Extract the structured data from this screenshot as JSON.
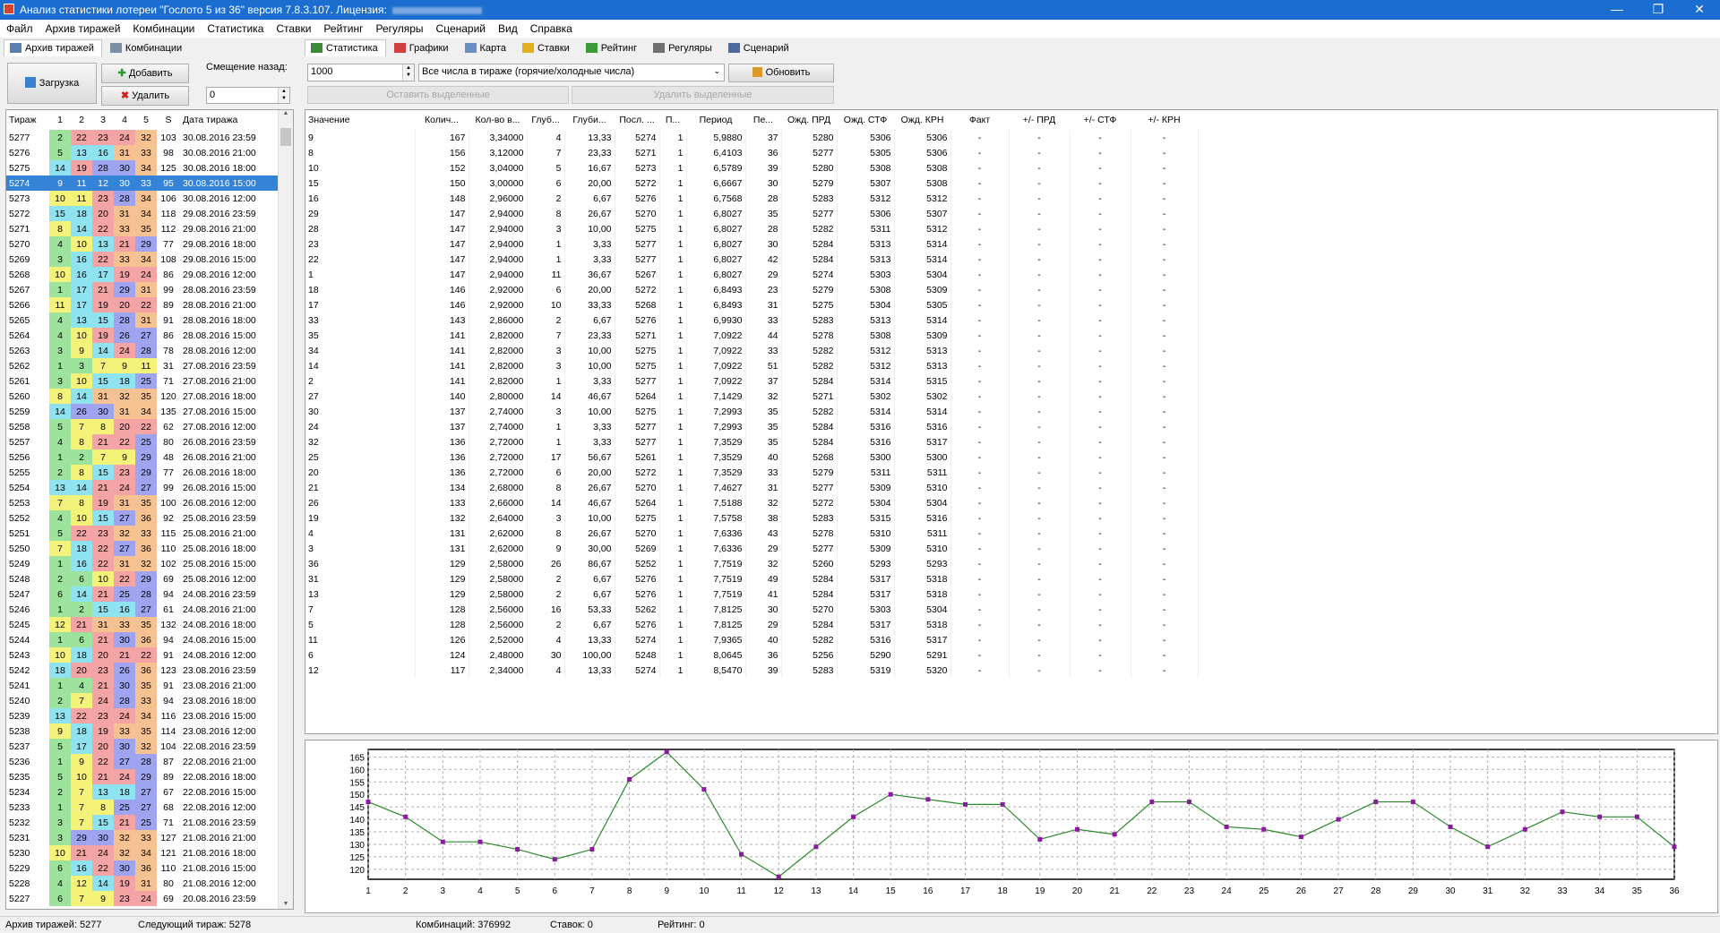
{
  "window": {
    "title": "Анализ статистики лотереи \"Гослото 5 из 36\" версия 7.8.3.107. Лицензия:",
    "min": "—",
    "max": "❐",
    "close": "✕"
  },
  "menu": [
    "Файл",
    "Архив тиражей",
    "Комбинации",
    "Статистика",
    "Ставки",
    "Рейтинг",
    "Регуляры",
    "Сценарий",
    "Вид",
    "Справка"
  ],
  "left_tabs": [
    {
      "label": "Архив тиражей",
      "icon": "archive-icon",
      "active": true
    },
    {
      "label": "Комбинации",
      "icon": "combinations-icon",
      "active": false
    }
  ],
  "right_tabs": [
    {
      "label": "Статистика",
      "icon": "statistics-icon",
      "active": true
    },
    {
      "label": "Графики",
      "icon": "graph-icon",
      "active": false
    },
    {
      "label": "Карта",
      "icon": "map-icon",
      "active": false
    },
    {
      "label": "Ставки",
      "icon": "coins-icon",
      "active": false
    },
    {
      "label": "Рейтинг",
      "icon": "rating-icon",
      "active": false
    },
    {
      "label": "Регуляры",
      "icon": "regulars-icon",
      "active": false
    },
    {
      "label": "Сценарий",
      "icon": "scenario-icon",
      "active": false
    }
  ],
  "archive_controls": {
    "load": "Загрузка",
    "add": "Добавить",
    "delete": "Удалить",
    "offset_label": "Смещение назад:",
    "offset_value": "0"
  },
  "stats_controls": {
    "count_value": "1000",
    "filter_value": "Все числа в тираже (горячие/холодные числа)",
    "refresh": "Обновить",
    "keep_selected": "Оставить выделенные",
    "delete_selected": "Удалить выделенные"
  },
  "colors": {
    "green": "#9de39d",
    "cyan": "#8fe3f0",
    "red": "#f4a4a4",
    "yellow": "#f5f27a",
    "blue": "#9fa4f0",
    "orange": "#f7c291",
    "selected": "#3483d6"
  },
  "archive_headers": [
    "Тираж",
    "1",
    "2",
    "3",
    "4",
    "5",
    "S",
    "Дата тиража"
  ],
  "archive_rows": [
    [
      "5277",
      "2",
      "22",
      "23",
      "24",
      "32",
      "103",
      "30.08.2016 23:59"
    ],
    [
      "5276",
      "5",
      "13",
      "16",
      "31",
      "33",
      "98",
      "30.08.2016 21:00"
    ],
    [
      "5275",
      "14",
      "19",
      "28",
      "30",
      "34",
      "125",
      "30.08.2016 18:00"
    ],
    [
      "5274",
      "9",
      "11",
      "12",
      "30",
      "33",
      "95",
      "30.08.2016 15:00"
    ],
    [
      "5273",
      "10",
      "11",
      "23",
      "28",
      "34",
      "106",
      "30.08.2016 12:00"
    ],
    [
      "5272",
      "15",
      "18",
      "20",
      "31",
      "34",
      "118",
      "29.08.2016 23:59"
    ],
    [
      "5271",
      "8",
      "14",
      "22",
      "33",
      "35",
      "112",
      "29.08.2016 21:00"
    ],
    [
      "5270",
      "4",
      "10",
      "13",
      "21",
      "29",
      "77",
      "29.08.2016 18:00"
    ],
    [
      "5269",
      "3",
      "16",
      "22",
      "33",
      "34",
      "108",
      "29.08.2016 15:00"
    ],
    [
      "5268",
      "10",
      "16",
      "17",
      "19",
      "24",
      "86",
      "29.08.2016 12:00"
    ],
    [
      "5267",
      "1",
      "17",
      "21",
      "29",
      "31",
      "99",
      "28.08.2016 23:59"
    ],
    [
      "5266",
      "11",
      "17",
      "19",
      "20",
      "22",
      "89",
      "28.08.2016 21:00"
    ],
    [
      "5265",
      "4",
      "13",
      "15",
      "28",
      "31",
      "91",
      "28.08.2016 18:00"
    ],
    [
      "5264",
      "4",
      "10",
      "19",
      "26",
      "27",
      "86",
      "28.08.2016 15:00"
    ],
    [
      "5263",
      "3",
      "9",
      "14",
      "24",
      "28",
      "78",
      "28.08.2016 12:00"
    ],
    [
      "5262",
      "1",
      "3",
      "7",
      "9",
      "11",
      "31",
      "27.08.2016 23:59"
    ],
    [
      "5261",
      "3",
      "10",
      "15",
      "18",
      "25",
      "71",
      "27.08.2016 21:00"
    ],
    [
      "5260",
      "8",
      "14",
      "31",
      "32",
      "35",
      "120",
      "27.08.2016 18:00"
    ],
    [
      "5259",
      "14",
      "26",
      "30",
      "31",
      "34",
      "135",
      "27.08.2016 15:00"
    ],
    [
      "5258",
      "5",
      "7",
      "8",
      "20",
      "22",
      "62",
      "27.08.2016 12:00"
    ],
    [
      "5257",
      "4",
      "8",
      "21",
      "22",
      "25",
      "80",
      "26.08.2016 23:59"
    ],
    [
      "5256",
      "1",
      "2",
      "7",
      "9",
      "29",
      "48",
      "26.08.2016 21:00"
    ],
    [
      "5255",
      "2",
      "8",
      "15",
      "23",
      "29",
      "77",
      "26.08.2016 18:00"
    ],
    [
      "5254",
      "13",
      "14",
      "21",
      "24",
      "27",
      "99",
      "26.08.2016 15:00"
    ],
    [
      "5253",
      "7",
      "8",
      "19",
      "31",
      "35",
      "100",
      "26.08.2016 12:00"
    ],
    [
      "5252",
      "4",
      "10",
      "15",
      "27",
      "36",
      "92",
      "25.08.2016 23:59"
    ],
    [
      "5251",
      "5",
      "22",
      "23",
      "32",
      "33",
      "115",
      "25.08.2016 21:00"
    ],
    [
      "5250",
      "7",
      "18",
      "22",
      "27",
      "36",
      "110",
      "25.08.2016 18:00"
    ],
    [
      "5249",
      "1",
      "16",
      "22",
      "31",
      "32",
      "102",
      "25.08.2016 15:00"
    ],
    [
      "5248",
      "2",
      "6",
      "10",
      "22",
      "29",
      "69",
      "25.08.2016 12:00"
    ],
    [
      "5247",
      "6",
      "14",
      "21",
      "25",
      "28",
      "94",
      "24.08.2016 23:59"
    ],
    [
      "5246",
      "1",
      "2",
      "15",
      "16",
      "27",
      "61",
      "24.08.2016 21:00"
    ],
    [
      "5245",
      "12",
      "21",
      "31",
      "33",
      "35",
      "132",
      "24.08.2016 18:00"
    ],
    [
      "5244",
      "1",
      "6",
      "21",
      "30",
      "36",
      "94",
      "24.08.2016 15:00"
    ],
    [
      "5243",
      "10",
      "18",
      "20",
      "21",
      "22",
      "91",
      "24.08.2016 12:00"
    ],
    [
      "5242",
      "18",
      "20",
      "23",
      "26",
      "36",
      "123",
      "23.08.2016 23:59"
    ],
    [
      "5241",
      "1",
      "4",
      "21",
      "30",
      "35",
      "91",
      "23.08.2016 21:00"
    ],
    [
      "5240",
      "2",
      "7",
      "24",
      "28",
      "33",
      "94",
      "23.08.2016 18:00"
    ],
    [
      "5239",
      "13",
      "22",
      "23",
      "24",
      "34",
      "116",
      "23.08.2016 15:00"
    ],
    [
      "5238",
      "9",
      "18",
      "19",
      "33",
      "35",
      "114",
      "23.08.2016 12:00"
    ],
    [
      "5237",
      "5",
      "17",
      "20",
      "30",
      "32",
      "104",
      "22.08.2016 23:59"
    ],
    [
      "5236",
      "1",
      "9",
      "22",
      "27",
      "28",
      "87",
      "22.08.2016 21:00"
    ],
    [
      "5235",
      "5",
      "10",
      "21",
      "24",
      "29",
      "89",
      "22.08.2016 18:00"
    ],
    [
      "5234",
      "2",
      "7",
      "13",
      "18",
      "27",
      "67",
      "22.08.2016 15:00"
    ],
    [
      "5233",
      "1",
      "7",
      "8",
      "25",
      "27",
      "68",
      "22.08.2016 12:00"
    ],
    [
      "5232",
      "3",
      "7",
      "15",
      "21",
      "25",
      "71",
      "21.08.2016 23:59"
    ],
    [
      "5231",
      "3",
      "29",
      "30",
      "32",
      "33",
      "127",
      "21.08.2016 21:00"
    ],
    [
      "5230",
      "10",
      "21",
      "24",
      "32",
      "34",
      "121",
      "21.08.2016 18:00"
    ],
    [
      "5229",
      "6",
      "16",
      "22",
      "30",
      "36",
      "110",
      "21.08.2016 15:00"
    ],
    [
      "5228",
      "4",
      "12",
      "14",
      "19",
      "31",
      "80",
      "21.08.2016 12:00"
    ],
    [
      "5227",
      "6",
      "7",
      "9",
      "23",
      "24",
      "69",
      "20.08.2016 23:59"
    ]
  ],
  "stats_headers": [
    "Значение",
    "Колич...",
    "Кол-во в...",
    "Глуб...",
    "Глуби...",
    "Посл. ...",
    "П...",
    "Период",
    "Пе...",
    "Ожд. ПРД",
    "Ожд. СТФ",
    "Ожд. КРН",
    "Факт",
    "+/- ПРД",
    "+/- СТФ",
    "+/- КРН"
  ],
  "stats_rows": [
    [
      "9",
      "167",
      "3,34000",
      "4",
      "13,33",
      "5274",
      "1",
      "5,9880",
      "37",
      "5280",
      "5306",
      "5306",
      "-",
      "-",
      "-",
      "-"
    ],
    [
      "8",
      "156",
      "3,12000",
      "7",
      "23,33",
      "5271",
      "1",
      "6,4103",
      "36",
      "5277",
      "5305",
      "5306",
      "-",
      "-",
      "-",
      "-"
    ],
    [
      "10",
      "152",
      "3,04000",
      "5",
      "16,67",
      "5273",
      "1",
      "6,5789",
      "39",
      "5280",
      "5308",
      "5308",
      "-",
      "-",
      "-",
      "-"
    ],
    [
      "15",
      "150",
      "3,00000",
      "6",
      "20,00",
      "5272",
      "1",
      "6,6667",
      "30",
      "5279",
      "5307",
      "5308",
      "-",
      "-",
      "-",
      "-"
    ],
    [
      "16",
      "148",
      "2,96000",
      "2",
      "6,67",
      "5276",
      "1",
      "6,7568",
      "28",
      "5283",
      "5312",
      "5312",
      "-",
      "-",
      "-",
      "-"
    ],
    [
      "29",
      "147",
      "2,94000",
      "8",
      "26,67",
      "5270",
      "1",
      "6,8027",
      "35",
      "5277",
      "5306",
      "5307",
      "-",
      "-",
      "-",
      "-"
    ],
    [
      "28",
      "147",
      "2,94000",
      "3",
      "10,00",
      "5275",
      "1",
      "6,8027",
      "28",
      "5282",
      "5311",
      "5312",
      "-",
      "-",
      "-",
      "-"
    ],
    [
      "23",
      "147",
      "2,94000",
      "1",
      "3,33",
      "5277",
      "1",
      "6,8027",
      "30",
      "5284",
      "5313",
      "5314",
      "-",
      "-",
      "-",
      "-"
    ],
    [
      "22",
      "147",
      "2,94000",
      "1",
      "3,33",
      "5277",
      "1",
      "6,8027",
      "42",
      "5284",
      "5313",
      "5314",
      "-",
      "-",
      "-",
      "-"
    ],
    [
      "1",
      "147",
      "2,94000",
      "11",
      "36,67",
      "5267",
      "1",
      "6,8027",
      "29",
      "5274",
      "5303",
      "5304",
      "-",
      "-",
      "-",
      "-"
    ],
    [
      "18",
      "146",
      "2,92000",
      "6",
      "20,00",
      "5272",
      "1",
      "6,8493",
      "23",
      "5279",
      "5308",
      "5309",
      "-",
      "-",
      "-",
      "-"
    ],
    [
      "17",
      "146",
      "2,92000",
      "10",
      "33,33",
      "5268",
      "1",
      "6,8493",
      "31",
      "5275",
      "5304",
      "5305",
      "-",
      "-",
      "-",
      "-"
    ],
    [
      "33",
      "143",
      "2,86000",
      "2",
      "6,67",
      "5276",
      "1",
      "6,9930",
      "33",
      "5283",
      "5313",
      "5314",
      "-",
      "-",
      "-",
      "-"
    ],
    [
      "35",
      "141",
      "2,82000",
      "7",
      "23,33",
      "5271",
      "1",
      "7,0922",
      "44",
      "5278",
      "5308",
      "5309",
      "-",
      "-",
      "-",
      "-"
    ],
    [
      "34",
      "141",
      "2,82000",
      "3",
      "10,00",
      "5275",
      "1",
      "7,0922",
      "33",
      "5282",
      "5312",
      "5313",
      "-",
      "-",
      "-",
      "-"
    ],
    [
      "14",
      "141",
      "2,82000",
      "3",
      "10,00",
      "5275",
      "1",
      "7,0922",
      "51",
      "5282",
      "5312",
      "5313",
      "-",
      "-",
      "-",
      "-"
    ],
    [
      "2",
      "141",
      "2,82000",
      "1",
      "3,33",
      "5277",
      "1",
      "7,0922",
      "37",
      "5284",
      "5314",
      "5315",
      "-",
      "-",
      "-",
      "-"
    ],
    [
      "27",
      "140",
      "2,80000",
      "14",
      "46,67",
      "5264",
      "1",
      "7,1429",
      "32",
      "5271",
      "5302",
      "5302",
      "-",
      "-",
      "-",
      "-"
    ],
    [
      "30",
      "137",
      "2,74000",
      "3",
      "10,00",
      "5275",
      "1",
      "7,2993",
      "35",
      "5282",
      "5314",
      "5314",
      "-",
      "-",
      "-",
      "-"
    ],
    [
      "24",
      "137",
      "2,74000",
      "1",
      "3,33",
      "5277",
      "1",
      "7,2993",
      "35",
      "5284",
      "5316",
      "5316",
      "-",
      "-",
      "-",
      "-"
    ],
    [
      "32",
      "136",
      "2,72000",
      "1",
      "3,33",
      "5277",
      "1",
      "7,3529",
      "35",
      "5284",
      "5316",
      "5317",
      "-",
      "-",
      "-",
      "-"
    ],
    [
      "25",
      "136",
      "2,72000",
      "17",
      "56,67",
      "5261",
      "1",
      "7,3529",
      "40",
      "5268",
      "5300",
      "5300",
      "-",
      "-",
      "-",
      "-"
    ],
    [
      "20",
      "136",
      "2,72000",
      "6",
      "20,00",
      "5272",
      "1",
      "7,3529",
      "33",
      "5279",
      "5311",
      "5311",
      "-",
      "-",
      "-",
      "-"
    ],
    [
      "21",
      "134",
      "2,68000",
      "8",
      "26,67",
      "5270",
      "1",
      "7,4627",
      "31",
      "5277",
      "5309",
      "5310",
      "-",
      "-",
      "-",
      "-"
    ],
    [
      "26",
      "133",
      "2,66000",
      "14",
      "46,67",
      "5264",
      "1",
      "7,5188",
      "32",
      "5272",
      "5304",
      "5304",
      "-",
      "-",
      "-",
      "-"
    ],
    [
      "19",
      "132",
      "2,64000",
      "3",
      "10,00",
      "5275",
      "1",
      "7,5758",
      "38",
      "5283",
      "5315",
      "5316",
      "-",
      "-",
      "-",
      "-"
    ],
    [
      "4",
      "131",
      "2,62000",
      "8",
      "26,67",
      "5270",
      "1",
      "7,6336",
      "43",
      "5278",
      "5310",
      "5311",
      "-",
      "-",
      "-",
      "-"
    ],
    [
      "3",
      "131",
      "2,62000",
      "9",
      "30,00",
      "5269",
      "1",
      "7,6336",
      "29",
      "5277",
      "5309",
      "5310",
      "-",
      "-",
      "-",
      "-"
    ],
    [
      "36",
      "129",
      "2,58000",
      "26",
      "86,67",
      "5252",
      "1",
      "7,7519",
      "32",
      "5260",
      "5293",
      "5293",
      "-",
      "-",
      "-",
      "-"
    ],
    [
      "31",
      "129",
      "2,58000",
      "2",
      "6,67",
      "5276",
      "1",
      "7,7519",
      "49",
      "5284",
      "5317",
      "5318",
      "-",
      "-",
      "-",
      "-"
    ],
    [
      "13",
      "129",
      "2,58000",
      "2",
      "6,67",
      "5276",
      "1",
      "7,7519",
      "41",
      "5284",
      "5317",
      "5318",
      "-",
      "-",
      "-",
      "-"
    ],
    [
      "7",
      "128",
      "2,56000",
      "16",
      "53,33",
      "5262",
      "1",
      "7,8125",
      "30",
      "5270",
      "5303",
      "5304",
      "-",
      "-",
      "-",
      "-"
    ],
    [
      "5",
      "128",
      "2,56000",
      "2",
      "6,67",
      "5276",
      "1",
      "7,8125",
      "29",
      "5284",
      "5317",
      "5318",
      "-",
      "-",
      "-",
      "-"
    ],
    [
      "11",
      "126",
      "2,52000",
      "4",
      "13,33",
      "5274",
      "1",
      "7,9365",
      "40",
      "5282",
      "5316",
      "5317",
      "-",
      "-",
      "-",
      "-"
    ],
    [
      "6",
      "124",
      "2,48000",
      "30",
      "100,00",
      "5248",
      "1",
      "8,0645",
      "36",
      "5256",
      "5290",
      "5291",
      "-",
      "-",
      "-",
      "-"
    ],
    [
      "12",
      "117",
      "2,34000",
      "4",
      "13,33",
      "5274",
      "1",
      "8,5470",
      "39",
      "5283",
      "5319",
      "5320",
      "-",
      "-",
      "-",
      "-"
    ]
  ],
  "chart_data": {
    "type": "line",
    "x": [
      1,
      2,
      3,
      4,
      5,
      6,
      7,
      8,
      9,
      10,
      11,
      12,
      13,
      14,
      15,
      16,
      17,
      18,
      19,
      20,
      21,
      22,
      23,
      24,
      25,
      26,
      27,
      28,
      29,
      30,
      31,
      32,
      33,
      34,
      35,
      36
    ],
    "series": [
      {
        "values": [
          147,
          141,
          131,
          131,
          128,
          124,
          128,
          156,
          167,
          152,
          126,
          117,
          129,
          141,
          150,
          148,
          146,
          146,
          132,
          136,
          134,
          147,
          147,
          137,
          136,
          133,
          140,
          147,
          147,
          137,
          129,
          136,
          143,
          141,
          141,
          129
        ]
      }
    ],
    "yticks": [
      120,
      125,
      130,
      135,
      140,
      145,
      150,
      155,
      160,
      165
    ],
    "ylim": [
      116,
      168
    ],
    "xlim": [
      1,
      36
    ],
    "line_color": "#2a8a2a",
    "marker_color": "#8b1aa0",
    "grid": true
  },
  "status": {
    "archive": "Архив тиражей: 5277",
    "next": "Следующий тираж: 5278",
    "combinations": "Комбинаций: 376992",
    "bets": "Ставок: 0",
    "rating": "Рейтинг: 0"
  }
}
